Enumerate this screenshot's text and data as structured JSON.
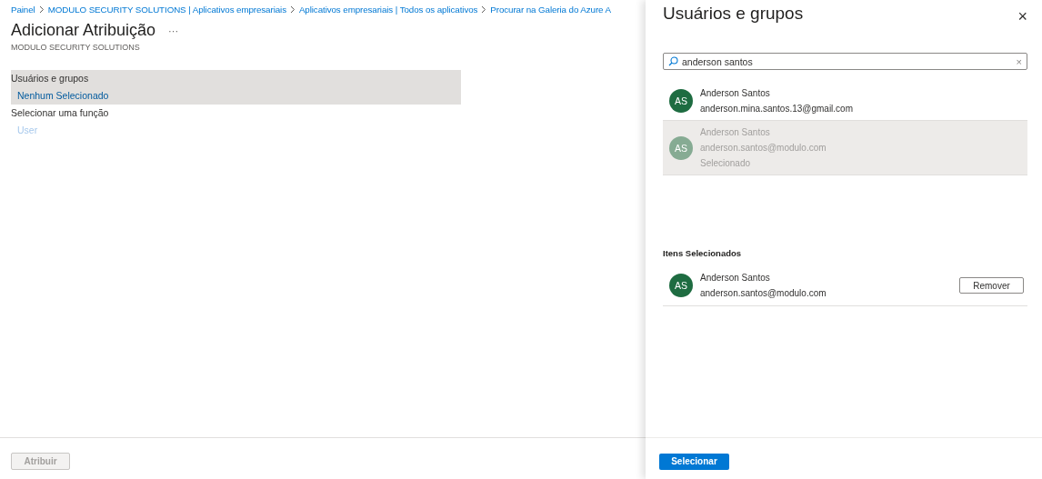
{
  "breadcrumb": [
    "Painel",
    "MODULO SECURITY SOLUTIONS | Aplicativos empresariais",
    "Aplicativos empresariais | Todos os aplicativos",
    "Procurar na Galeria do Azure A"
  ],
  "page": {
    "title": "Adicionar Atribuição",
    "more": "···",
    "subtitle": "MODULO SECURITY SOLUTIONS"
  },
  "fields": [
    {
      "label": "Usuários e grupos",
      "value": "Nenhum Selecionado",
      "selected": true,
      "disabled": false
    },
    {
      "label": "Selecionar uma função",
      "value": "User",
      "selected": false,
      "disabled": true
    }
  ],
  "footer": {
    "button": {
      "label": "Atribuir",
      "disabled": true
    }
  },
  "panel": {
    "title": "Usuários e grupos",
    "close": "×",
    "search": {
      "value": "anderson santos",
      "clear": "×"
    },
    "results": [
      {
        "initials": "AS",
        "name": "Anderson Santos",
        "email": "anderson.mina.santos.13@gmail.com",
        "selected": false
      },
      {
        "initials": "AS",
        "name": "Anderson Santos",
        "email": "anderson.santos@modulo.com",
        "selected": true,
        "status": "Selecionado"
      }
    ],
    "selected_heading": "Itens Selecionados",
    "selected_items": [
      {
        "initials": "AS",
        "name": "Anderson Santos",
        "email": "anderson.santos@modulo.com",
        "action": "Remover"
      }
    ],
    "button": {
      "label": "Selecionar",
      "disabled": false
    }
  }
}
